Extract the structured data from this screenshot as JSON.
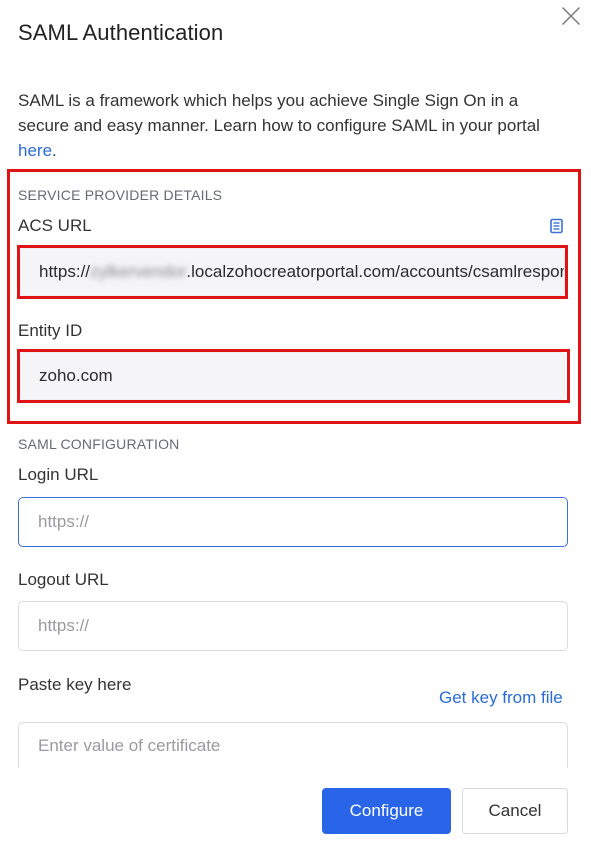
{
  "dialog": {
    "title": "SAML Authentication",
    "description": "SAML is a framework which helps you achieve Single Sign On in a secure and easy manner. Learn how to configure SAML in your portal ",
    "description_link": "here",
    "description_end": "."
  },
  "service_provider": {
    "heading": "SERVICE PROVIDER DETAILS",
    "acs_label": "ACS URL",
    "acs_prefix": "https://",
    "acs_redacted": "zylkervendor",
    "acs_suffix": ".localzohocreatorportal.com/accounts/csamlresponse",
    "entity_label": "Entity ID",
    "entity_value": "zoho.com"
  },
  "saml_config": {
    "heading": "SAML CONFIGURATION",
    "login_label": "Login URL",
    "login_placeholder": "https://",
    "logout_label": "Logout URL",
    "logout_placeholder": "https://",
    "key_label": "Paste key here",
    "key_link": "Get key from file",
    "key_placeholder": "Enter value of certificate"
  },
  "actions": {
    "configure": "Configure",
    "cancel": "Cancel"
  },
  "colors": {
    "accent": "#2965e8",
    "link": "#2a6cd6",
    "highlight_box": "#e01414"
  }
}
